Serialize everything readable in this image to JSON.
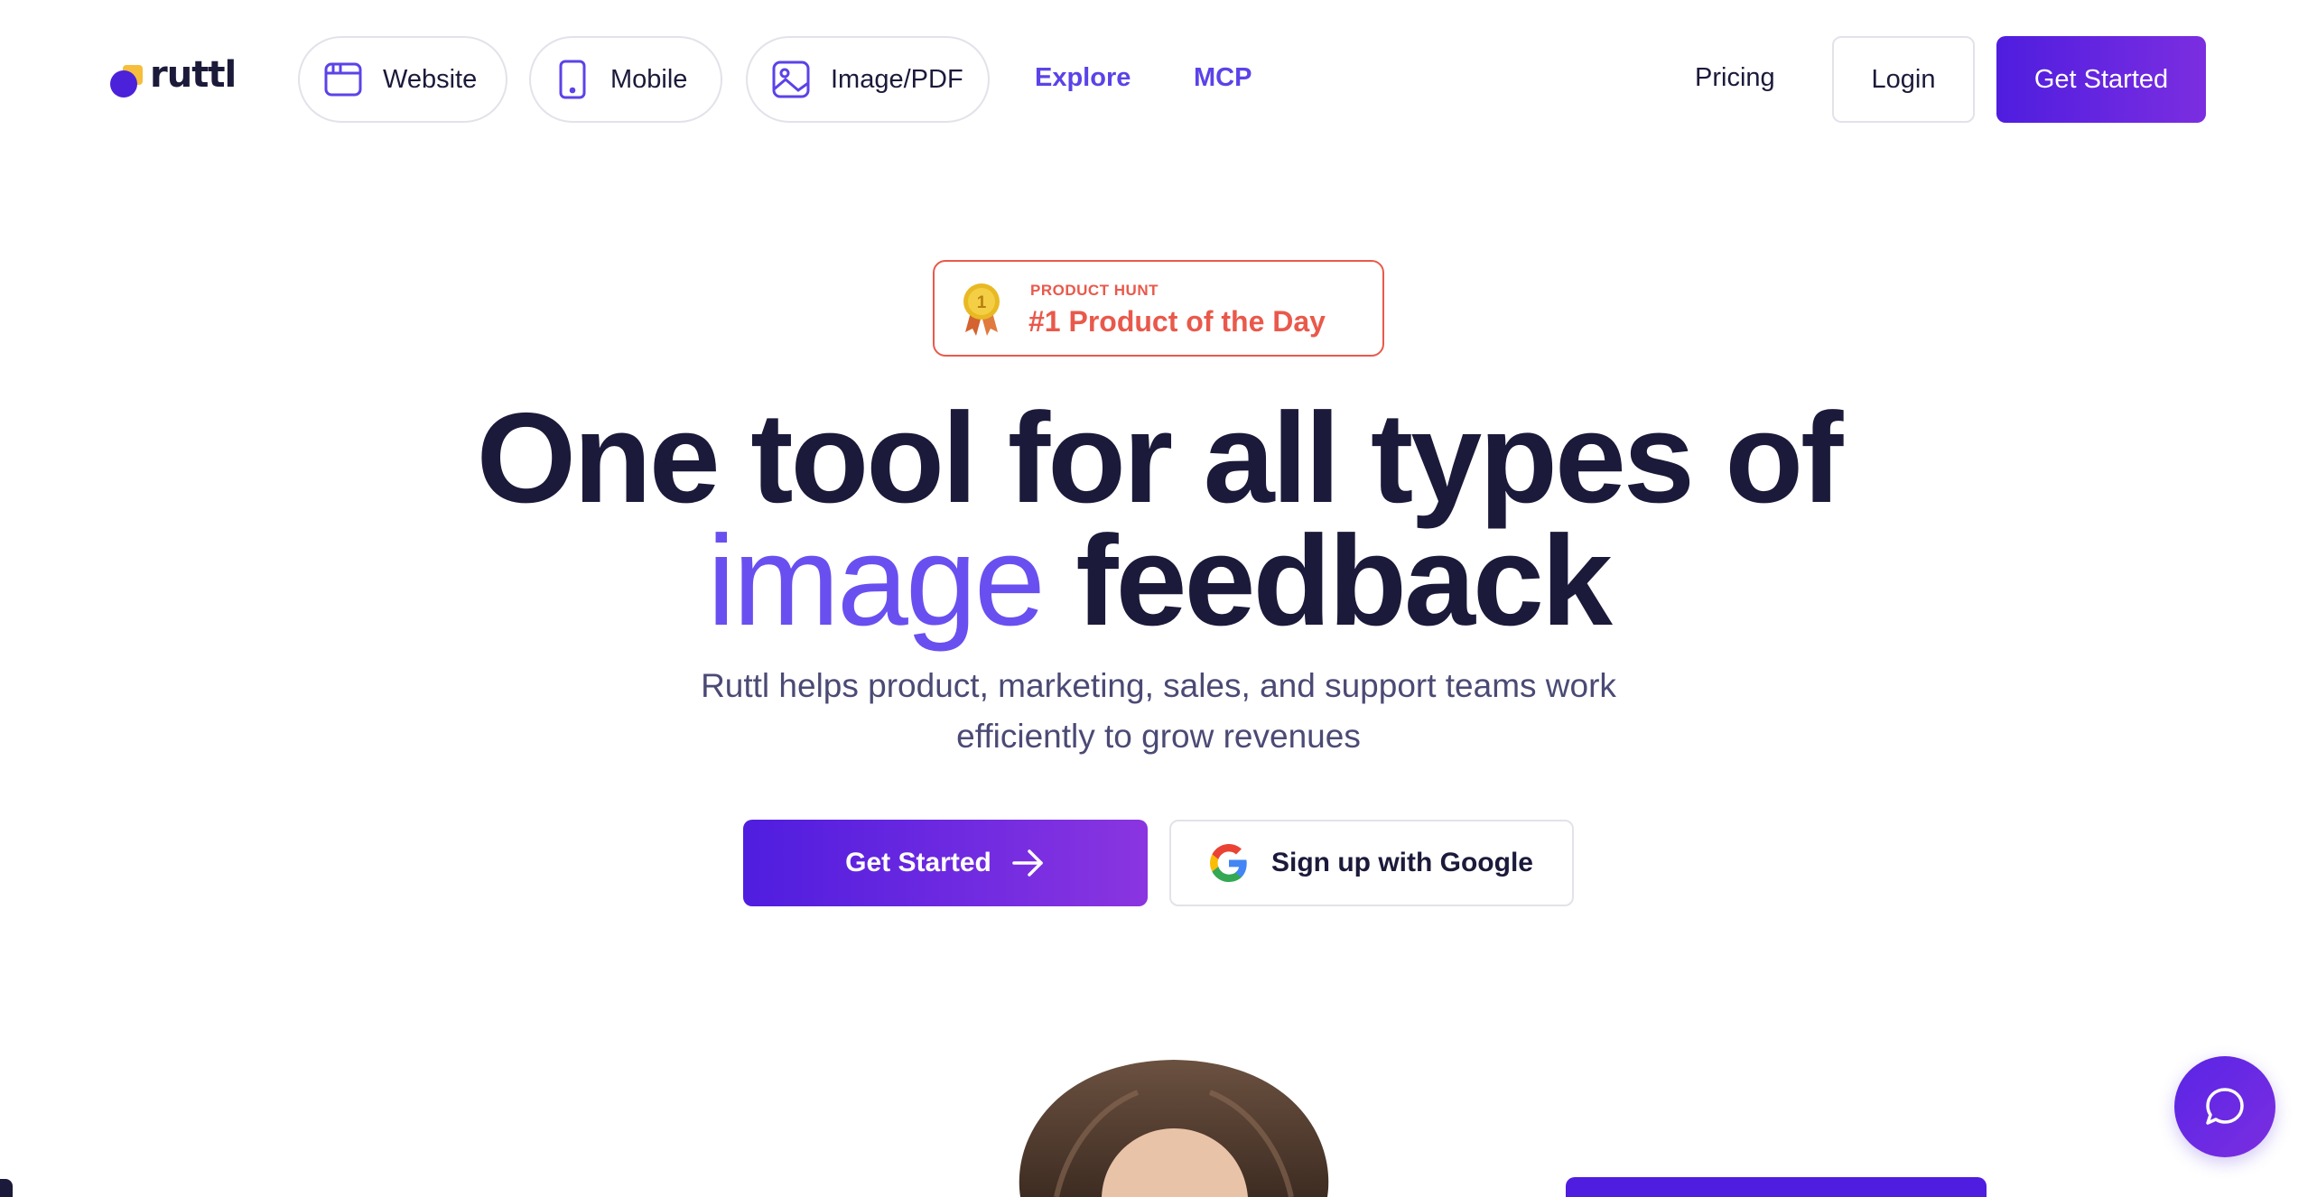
{
  "nav": {
    "brand": "ruttl",
    "pills": [
      {
        "label": "Website",
        "icon": "browser-window-icon"
      },
      {
        "label": "Mobile",
        "icon": "mobile-phone-icon"
      },
      {
        "label": "Image/PDF",
        "icon": "image-icon"
      }
    ],
    "links": {
      "explore": "Explore",
      "mcp": "MCP",
      "pricing": "Pricing"
    },
    "login": "Login",
    "get_started": "Get Started"
  },
  "badge": {
    "kicker": "PRODUCT HUNT",
    "title": "#1 Product of the Day",
    "medal_number": "1"
  },
  "hero": {
    "line1": "One tool for all types of",
    "accent": "image",
    "line2_rest": "feedback",
    "subtitle_line1": "Ruttl helps product, marketing, sales, and support teams work",
    "subtitle_line2": "efficiently to grow revenues"
  },
  "cta": {
    "primary": "Get Started",
    "google": "Sign up with Google"
  },
  "colors": {
    "brand_purple": "#4f1ddf",
    "accent_violet": "#6a4ff0",
    "badge_red": "#e9594b",
    "text_dark": "#1b1a3a",
    "logo_yellow": "#f6be3c"
  }
}
